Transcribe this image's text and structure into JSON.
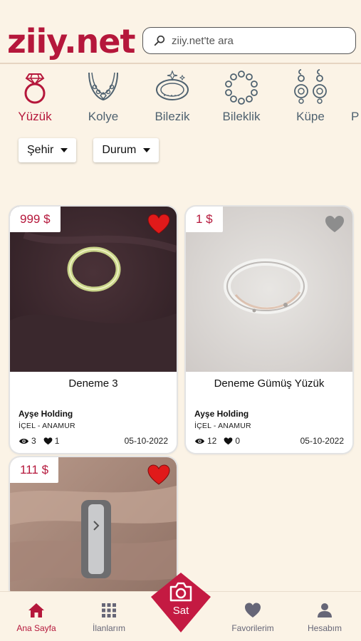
{
  "brand": {
    "logo_text": "ziiy.net",
    "color": "#b5173b"
  },
  "search": {
    "placeholder": "ziiy.net'te ara",
    "icon": "search-icon"
  },
  "categories": [
    {
      "label": "Yüzük",
      "icon": "ring-icon",
      "active": true
    },
    {
      "label": "Kolye",
      "icon": "necklace-icon",
      "active": false
    },
    {
      "label": "Bilezik",
      "icon": "bangle-icon",
      "active": false
    },
    {
      "label": "Bileklik",
      "icon": "bracelet-icon",
      "active": false
    },
    {
      "label": "Küpe",
      "icon": "earring-icon",
      "active": false
    },
    {
      "label": "P",
      "icon": "",
      "active": false
    }
  ],
  "filters": [
    {
      "label": "Şehir",
      "icon": "caret-down-icon"
    },
    {
      "label": "Durum",
      "icon": "caret-down-icon"
    }
  ],
  "listings": [
    {
      "price": "999 $",
      "title": "Deneme 3",
      "seller": "Ayşe Holding",
      "location": "İÇEL - ANAMUR",
      "views": "3",
      "likes": "1",
      "date": "05-10-2022",
      "favorited": true
    },
    {
      "price": "1 $",
      "title": "Deneme Gümüş Yüzük",
      "seller": "Ayşe Holding",
      "location": "İÇEL - ANAMUR",
      "views": "12",
      "likes": "0",
      "date": "05-10-2022",
      "favorited": false
    },
    {
      "price": "111 $",
      "title": "",
      "seller": "",
      "location": "",
      "views": "",
      "likes": "",
      "date": "",
      "favorited": true
    }
  ],
  "bottom_nav": {
    "home": {
      "label": "Ana Sayfa",
      "icon": "home-icon",
      "active": true
    },
    "listings": {
      "label": "İlanlarım",
      "icon": "grid-icon"
    },
    "sell": {
      "label": "Sat",
      "icon": "camera-icon"
    },
    "favorites": {
      "label": "Favorilerim",
      "icon": "heart-icon"
    },
    "account": {
      "label": "Hesabım",
      "icon": "person-icon"
    }
  }
}
